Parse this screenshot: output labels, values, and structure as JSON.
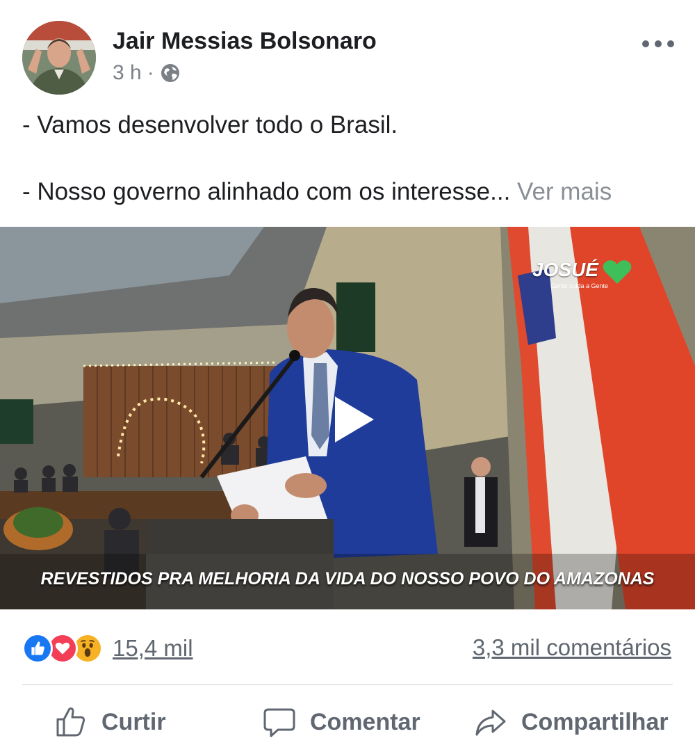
{
  "post": {
    "author": "Jair Messias Bolsonaro",
    "time": "3 h",
    "separator": "·",
    "audience_icon": "globe-icon",
    "more_icon": "more-options-icon",
    "text": {
      "line1": "- Vamos desenvolver todo o Brasil.",
      "line2": "- Nosso governo alinhado com os interesse...",
      "see_more": "Ver mais"
    }
  },
  "video": {
    "subtitle": "REVESTIDOS PRA MELHORIA DA VIDA DO NOSSO POVO DO AMAZONAS",
    "brand": "JOSUÉ",
    "brand_tagline": "Gente cuida a Gente",
    "play_icon": "play-icon"
  },
  "engagement": {
    "reactions": [
      "like-reaction-icon",
      "love-reaction-icon",
      "wow-reaction-icon"
    ],
    "reaction_count": "15,4 mil",
    "comments": "3,3 mil comentários"
  },
  "actions": {
    "like": "Curtir",
    "comment": "Comentar",
    "share": "Compartilhar"
  },
  "colors": {
    "like_blue": "#1877f2",
    "love_red": "#f33e58",
    "wow_yellow": "#f7b125",
    "secondary_text": "#606770"
  }
}
